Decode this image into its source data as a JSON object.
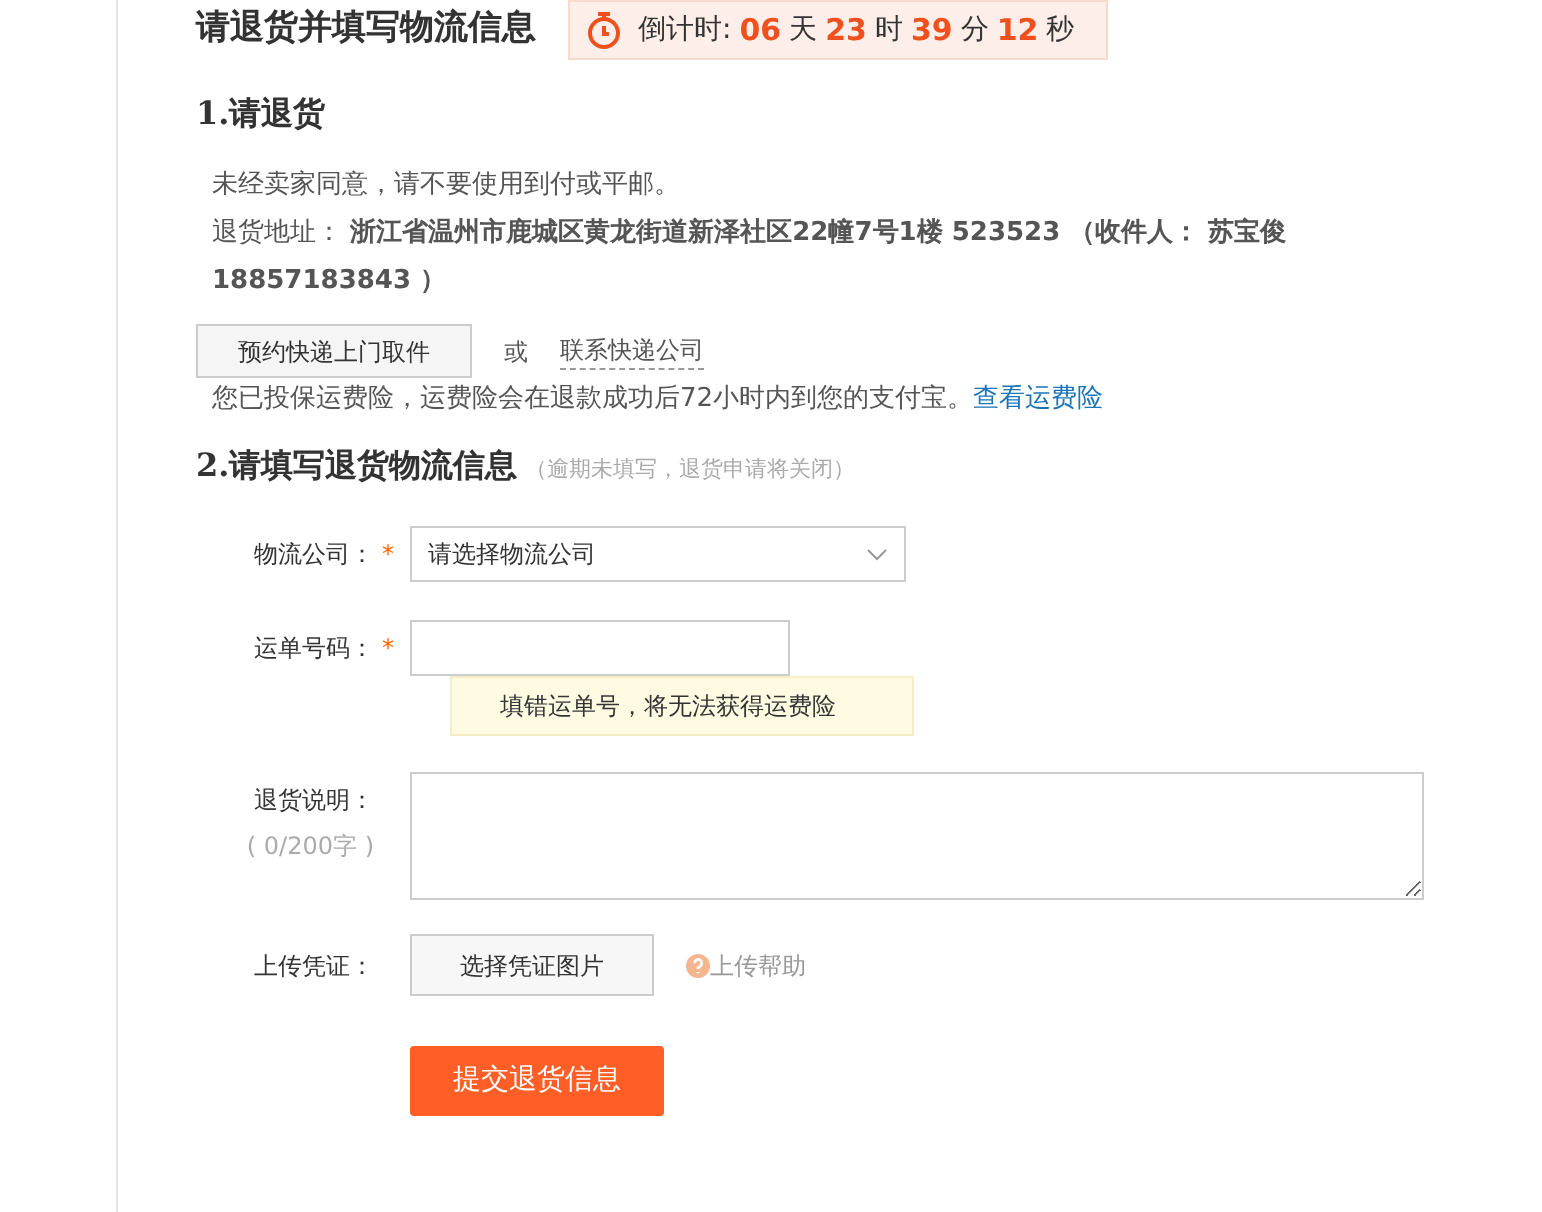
{
  "header": {
    "title": "请退货并填写物流信息",
    "countdown": [
      {
        "kind": "label",
        "text": "倒计时:"
      },
      {
        "kind": "num",
        "text": "06"
      },
      {
        "kind": "unit",
        "text": "天"
      },
      {
        "kind": "num",
        "text": "23"
      },
      {
        "kind": "unit",
        "text": "时"
      },
      {
        "kind": "num",
        "text": "39"
      },
      {
        "kind": "unit",
        "text": "分"
      },
      {
        "kind": "num",
        "text": "12"
      },
      {
        "kind": "unit",
        "text": "秒"
      }
    ]
  },
  "step1": {
    "title": "1.请退货",
    "notice": "未经卖家同意，请不要使用到付或平邮。",
    "address": "退货地址： **浙江省温州市鹿城区黄龙街道新泽社区22幢7号1楼 523523 （收件人： 苏宝俊 18857183843 ）**",
    "pickup_button": "预约快递上门取件",
    "or": "或",
    "contact_link": "联系快递公司",
    "insurance_note": "您已投保运费险，运费险会在退款成功后72小时内到您的支付宝。",
    "insurance_link": "查看运费险"
  },
  "step2": {
    "title": "2.请填写退货物流信息",
    "hint": "（逾期未填写，退货申请将关闭）",
    "fields": [
      {
        "kind": "select",
        "label": "物流公司：",
        "required_mark": "*",
        "value": "请选择物流公司"
      },
      {
        "kind": "input",
        "label": "运单号码：",
        "required_mark": "*",
        "tip": "填错运单号，将无法获得运费险"
      },
      {
        "kind": "textarea",
        "label": "退货说明：",
        "counter": "( 0/200字 )"
      },
      {
        "kind": "upload",
        "label": "上传凭证：",
        "button": "选择凭证图片",
        "help": "上传帮助"
      }
    ],
    "submit": "提交退货信息"
  }
}
